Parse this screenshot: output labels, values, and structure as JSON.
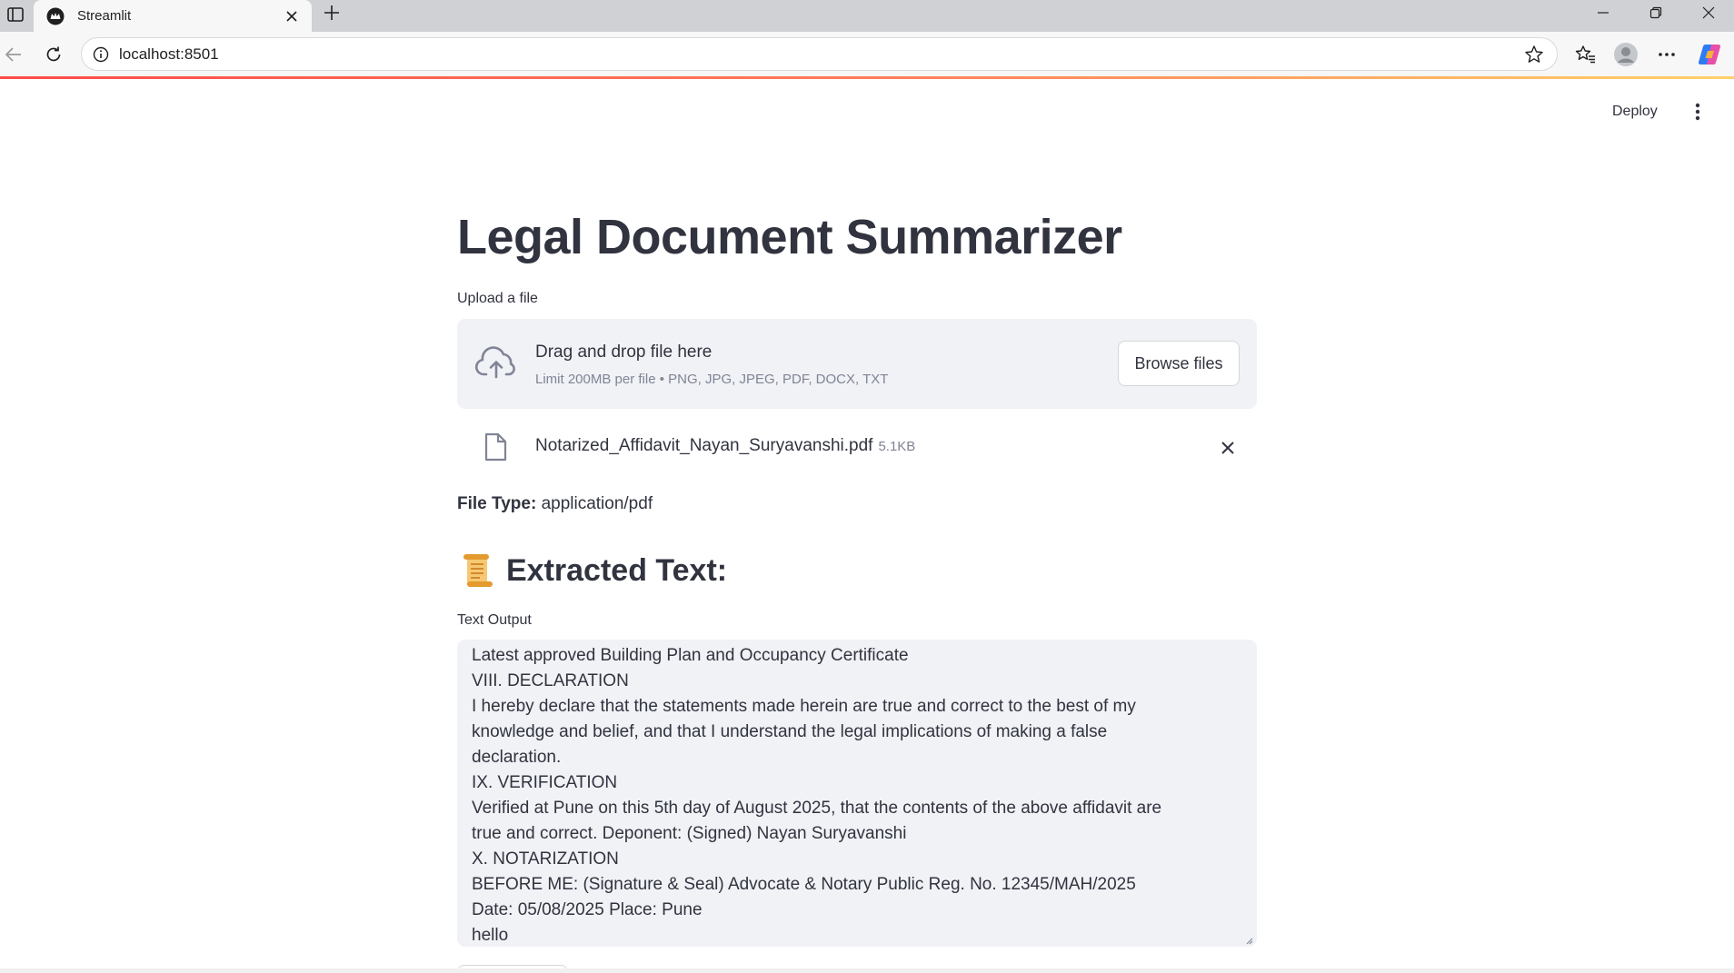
{
  "browser": {
    "tab_title": "Streamlit",
    "url": "localhost:8501"
  },
  "header": {
    "deploy_label": "Deploy"
  },
  "main": {
    "title": "Legal Document Summarizer",
    "uploader": {
      "label": "Upload a file",
      "drag_text": "Drag and drop file here",
      "limit_text": "Limit 200MB per file • PNG, JPG, JPEG, PDF, DOCX, TXT",
      "browse_label": "Browse files"
    },
    "file": {
      "name": "Notarized_Affidavit_Nayan_Suryavanshi.pdf",
      "size": "5.1KB"
    },
    "file_type": {
      "label": "File Type:",
      "value": "application/pdf"
    },
    "extracted_heading": "Extracted Text:",
    "text_output": {
      "label": "Text Output",
      "lines": [
        "Latest approved Building Plan and Occupancy Certificate",
        "VIII. DECLARATION",
        "I hereby declare that the statements made herein are true and correct to the best of my",
        "knowledge and belief, and that I understand the legal implications of making a false",
        "declaration.",
        "IX. VERIFICATION",
        "Verified at Pune on this 5th day of August 2025, that the contents of the above affidavit are",
        "true and correct. Deponent: (Signed) Nayan Suryavanshi",
        "X. NOTARIZATION",
        "BEFORE ME: (Signature & Seal) Advocate & Notary Public Reg. No. 12345/MAH/2025",
        "Date: 05/08/2025 Place: Pune",
        "hello"
      ]
    }
  },
  "icons": {
    "sidebar_toggle": "sidebar-toggle-icon",
    "favicon": "streamlit-crown-icon",
    "close": "close-icon",
    "new_tab": "plus-icon",
    "back": "back-arrow-icon",
    "reload": "reload-icon",
    "info": "info-icon",
    "favorite": "star-icon",
    "favorites_bar": "favorites-icon",
    "profile": "profile-icon",
    "more": "ellipsis-icon",
    "copilot": "copilot-icon",
    "upload": "cloud-upload-icon",
    "file": "file-icon",
    "scroll": "scroll-icon"
  },
  "colors": {
    "accent": "#ff4b4b",
    "panel_bg": "#f0f2f6",
    "text": "#31333f",
    "muted": "#808495"
  }
}
